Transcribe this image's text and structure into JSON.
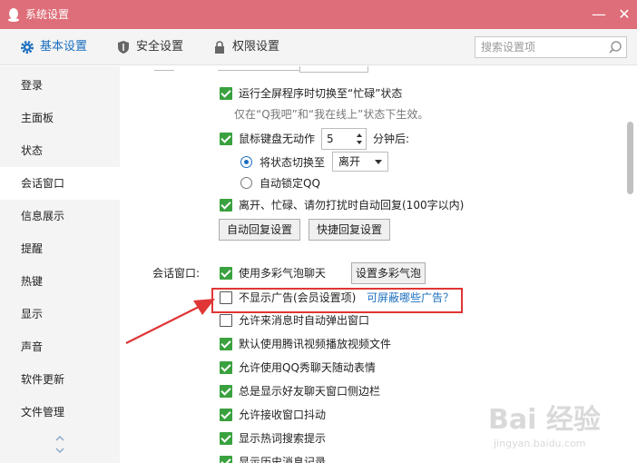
{
  "window": {
    "title": "系统设置",
    "minimize_glyph": "—",
    "close_glyph": "✕"
  },
  "tabs": [
    {
      "label": "基本设置",
      "icon": "gear-icon",
      "active": true
    },
    {
      "label": "安全设置",
      "icon": "shield-icon",
      "active": false
    },
    {
      "label": "权限设置",
      "icon": "lock-icon",
      "active": false
    }
  ],
  "search": {
    "placeholder": "搜索设置项",
    "value": ""
  },
  "sidebar": {
    "items": [
      {
        "label": "登录"
      },
      {
        "label": "主面板"
      },
      {
        "label": "状态"
      },
      {
        "label": "会话窗口",
        "active": true
      },
      {
        "label": "信息展示"
      },
      {
        "label": "提醒"
      },
      {
        "label": "热键"
      },
      {
        "label": "显示"
      },
      {
        "label": "声音"
      },
      {
        "label": "软件更新"
      },
      {
        "label": "文件管理"
      }
    ]
  },
  "status": {
    "fullscreen_busy": {
      "label": "运行全屏程序时切换至“忙碌”状态",
      "checked": true
    },
    "fullscreen_hint": "仅在“Q我吧”和“我在线上”状态下生效。",
    "idle": {
      "label_before": "鼠标键盘无动作",
      "minutes": "5",
      "label_after": "分钟后:",
      "checked": true
    },
    "radio_switch": {
      "label": "将状态切换至",
      "selected": true,
      "select_value": "离开"
    },
    "radio_lock": {
      "label": "自动锁定QQ",
      "selected": false
    },
    "auto_reply": {
      "label": "离开、忙碌、请勿打扰时自动回复(100字以内)",
      "checked": true
    },
    "auto_reply_button": "自动回复设置",
    "quick_reply_button": "快捷回复设置"
  },
  "session": {
    "section_label": "会话窗口:",
    "items": [
      {
        "label": "使用多彩气泡聊天",
        "checked": true
      },
      {
        "label": "不显示广告(会员设置项)",
        "checked": false
      },
      {
        "label": "允许来消息时自动弹出窗口",
        "checked": false
      },
      {
        "label": "默认使用腾讯视频播放视频文件",
        "checked": true
      },
      {
        "label": "允许使用QQ秀聊天随动表情",
        "checked": true
      },
      {
        "label": "总是显示好友聊天窗口侧边栏",
        "checked": true
      },
      {
        "label": "允许接收窗口抖动",
        "checked": true
      },
      {
        "label": "显示热词搜索提示",
        "checked": true
      },
      {
        "label": "显示历史消息记录",
        "checked": true
      }
    ],
    "bubble_button": "设置多彩气泡",
    "ad_link": "可屏蔽哪些广告？"
  },
  "watermark": {
    "brand": "Bai 经验",
    "url": "jingyan.baidu.com"
  },
  "colors": {
    "titlebar": "#de6e79",
    "accent": "#1a6ebe",
    "checkbox_on": "#3aa13f",
    "annotation": "#e03636"
  }
}
